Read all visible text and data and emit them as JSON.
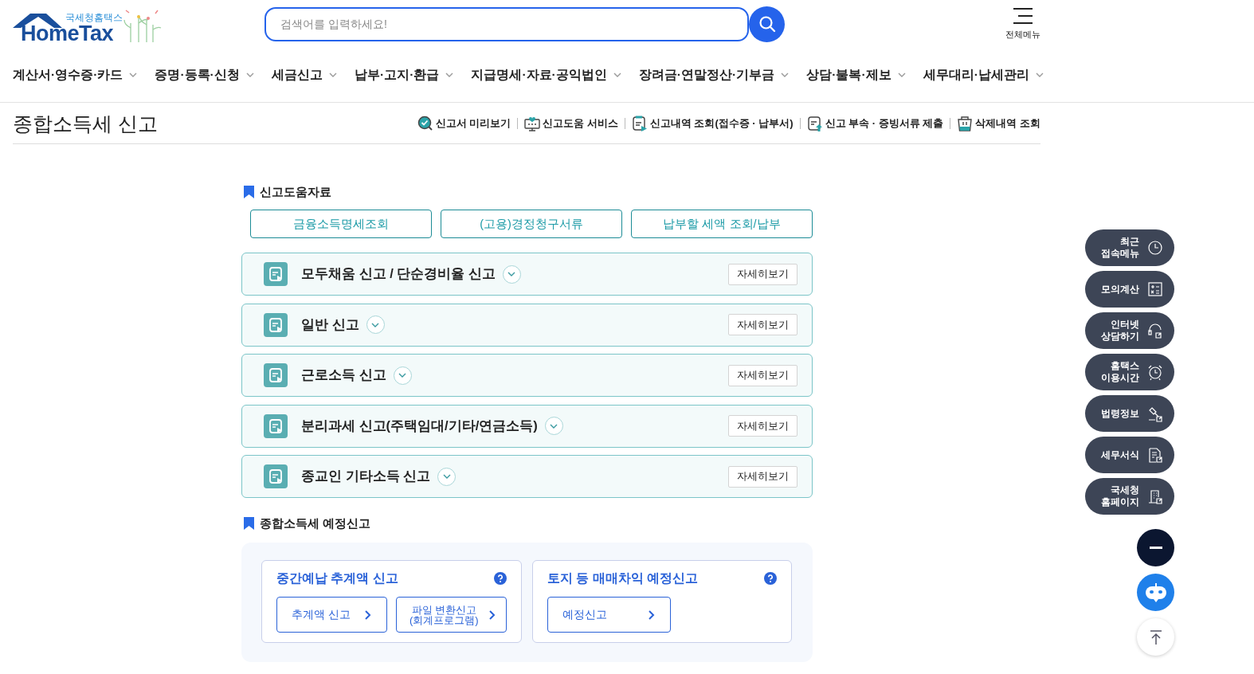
{
  "logo": {
    "subtitle": "국세청홈택스",
    "name": "HomeTax"
  },
  "search": {
    "placeholder": "검색어를 입력하세요!"
  },
  "menu_button": {
    "label": "전체메뉴"
  },
  "nav": [
    {
      "label": "계산서·영수증·카드"
    },
    {
      "label": "증명·등록·신청"
    },
    {
      "label": "세금신고"
    },
    {
      "label": "납부·고지·환급"
    },
    {
      "label": "지급명세·자료·공익법인"
    },
    {
      "label": "장려금·연말정산·기부금"
    },
    {
      "label": "상담·불복·제보"
    },
    {
      "label": "세무대리·납세관리"
    }
  ],
  "page": {
    "title": "종합소득세 신고",
    "links": [
      {
        "label": "신고서 미리보기"
      },
      {
        "label": "신고도움 서비스"
      },
      {
        "label": "신고내역 조회(접수증 · 납부서)"
      },
      {
        "label": "신고 부속 · 증빙서류 제출"
      },
      {
        "label": "삭제내역 조회"
      }
    ]
  },
  "help_section": {
    "title": "신고도움자료",
    "buttons": [
      "금융소득명세조회",
      "(고용)경정청구서류",
      "납부할 세액 조회/납부"
    ],
    "items": [
      {
        "title": "모두채움 신고 / 단순경비율 신고",
        "expanded": false,
        "button": "자세히보기"
      },
      {
        "title": "일반 신고",
        "expanded": false,
        "button": "자세히보기"
      },
      {
        "title": "근로소득 신고",
        "expanded": false,
        "button": "자세히보기"
      },
      {
        "title": "분리과세 신고(주택임대/기타/연금소득)",
        "expanded": false,
        "button": "자세히보기"
      },
      {
        "title": "종교인 기타소득 신고",
        "expanded": false,
        "button": "자세히보기"
      }
    ]
  },
  "interim_section": {
    "title": "종합소득세 예정신고",
    "cards": [
      {
        "title": "중간예납 추계액 신고",
        "buttons": [
          "추계액 신고",
          "파일 변환신고\n(회계프로그램)"
        ]
      },
      {
        "title": "토지 등 매매차익 예정신고",
        "buttons": [
          "예정신고"
        ]
      }
    ]
  },
  "quick_menu": [
    {
      "label": "최근\n접속메뉴"
    },
    {
      "label": "모의계산"
    },
    {
      "label": "인터넷\n상담하기"
    },
    {
      "label": "홈택스\n이용시간"
    },
    {
      "label": "법령정보"
    },
    {
      "label": "세무서식"
    },
    {
      "label": "국세청\n홈페이지"
    }
  ]
}
